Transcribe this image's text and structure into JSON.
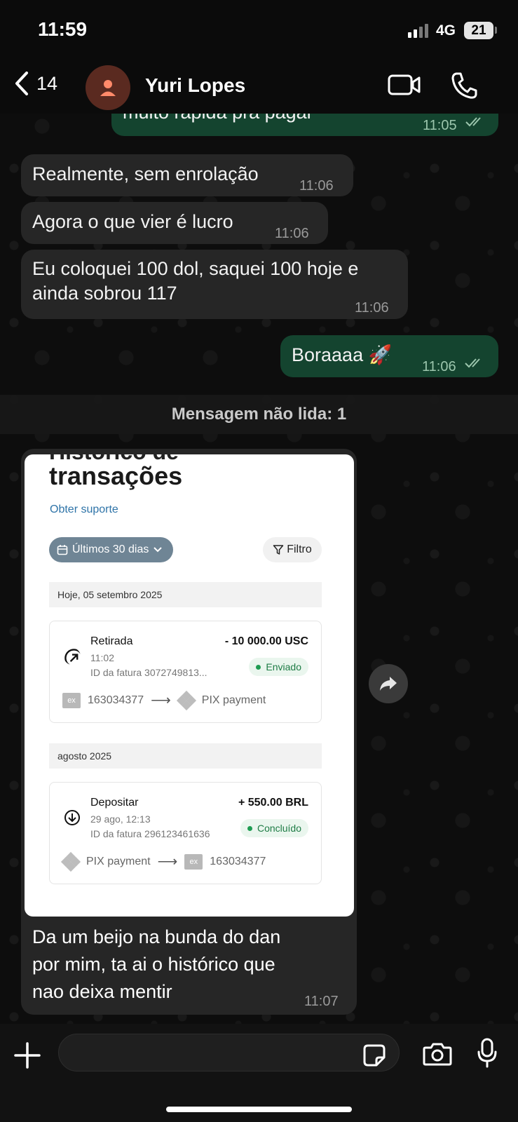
{
  "status_bar": {
    "time": "11:59",
    "network": "4G",
    "battery": "21"
  },
  "header": {
    "back_count": "14",
    "contact_name": "Yuri Lopes"
  },
  "messages": [
    {
      "dir": "out",
      "text": "muito rapida pra pagar",
      "time": "11:05"
    },
    {
      "dir": "in",
      "text": "Realmente, sem enrolação",
      "time": "11:06"
    },
    {
      "dir": "in",
      "text": "Agora o que vier é lucro",
      "time": "11:06"
    },
    {
      "dir": "in",
      "text_line1": "Eu coloquei 100 dol, saquei 100 hoje e",
      "text_line2": "ainda sobrou 117",
      "time": "11:06"
    },
    {
      "dir": "out",
      "text": "Boraaaa 🚀",
      "time": "11:06"
    }
  ],
  "unread_banner": "Mensagem não lida: 1",
  "image_message": {
    "title_cut": "Histórico de",
    "title": "transações",
    "support_link": "Obter suporte",
    "period_filter": "Últimos 30 dias",
    "filter_button": "Filtro",
    "groups": [
      {
        "date_label": "Hoje, 05 setembro 2025",
        "type": "Retirada",
        "time": "11:02",
        "invoice": "ID da fatura 3072749813...",
        "amount": "- 10 000.00 USC",
        "status": "Enviado",
        "from": "163034377",
        "to": "PIX payment",
        "from_badge": "ex"
      },
      {
        "date_label": "agosto 2025",
        "type": "Depositar",
        "time": "29 ago, 12:13",
        "invoice": "ID da fatura 296123461636",
        "amount": "+ 550.00 BRL",
        "status": "Concluído",
        "from": "PIX payment",
        "to": "163034377",
        "to_badge": "ex"
      }
    ],
    "caption_line1": "Da um beijo na bunda do dan",
    "caption_line2": "por mim, ta ai o histórico que",
    "caption_line3": "nao deixa mentir",
    "time": "11:07"
  },
  "colors": {
    "outgoing": "#14442f",
    "incoming": "#262626",
    "background": "#0d0d0d"
  }
}
